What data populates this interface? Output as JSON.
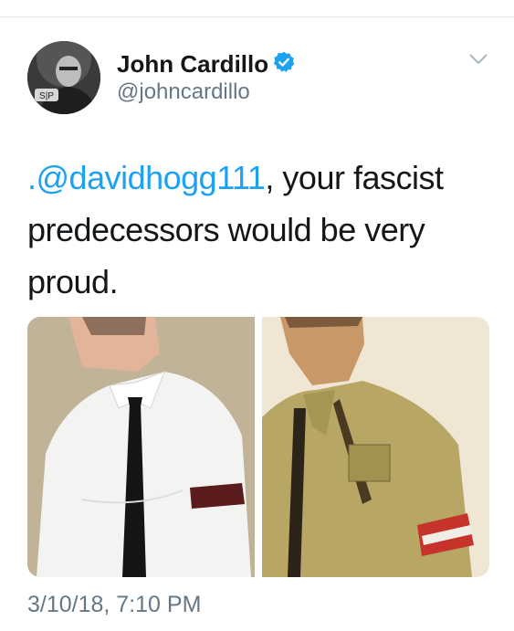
{
  "tweet": {
    "author": {
      "name": "John Cardillo",
      "handle": "@johncardillo",
      "verified": true,
      "avatar_icon": "profile-avatar",
      "avatar_badge_text": "S|P"
    },
    "text": {
      "mention": ".@davidhogg111",
      "body": ", your fascist predecessors would be very proud."
    },
    "media": [
      {
        "name": "photo-student-armband"
      },
      {
        "name": "photo-illustrated-uniform-armband"
      }
    ],
    "timestamp": "3/10/18, 7:10 PM"
  },
  "colors": {
    "link": "#1da1f2",
    "secondary_text": "#657786",
    "primary_text": "#14171a",
    "verified_badge": "#1da1f2"
  },
  "icons": {
    "verified": "verified-badge-icon",
    "menu": "chevron-down-icon"
  }
}
